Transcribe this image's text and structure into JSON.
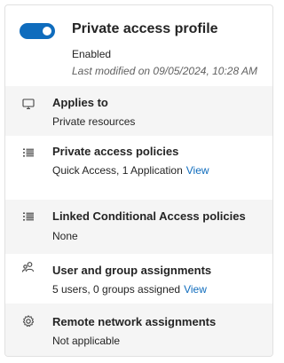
{
  "profile": {
    "title": "Private access profile",
    "toggle_state": "on",
    "status": "Enabled",
    "last_modified": "Last modified on 09/05/2024, 10:28 AM"
  },
  "sections": [
    {
      "icon": "monitor-icon",
      "title": "Applies to",
      "description": "Private resources"
    },
    {
      "icon": "list-icon",
      "title": "Private access policies",
      "description": "Quick Access, 1 Application",
      "link": "View"
    },
    {
      "icon": "list-icon",
      "title": "Linked Conditional Access policies",
      "description": "None"
    },
    {
      "icon": "people-icon",
      "title": "User and group assignments",
      "description": "5 users, 0 groups assigned",
      "link": "View"
    },
    {
      "icon": "gear-icon",
      "title": "Remote network assignments",
      "description": "Not applicable"
    }
  ],
  "colors": {
    "accent": "#0f6cbd",
    "shaded_row": "#f5f5f5",
    "border": "#e1e1e1"
  }
}
